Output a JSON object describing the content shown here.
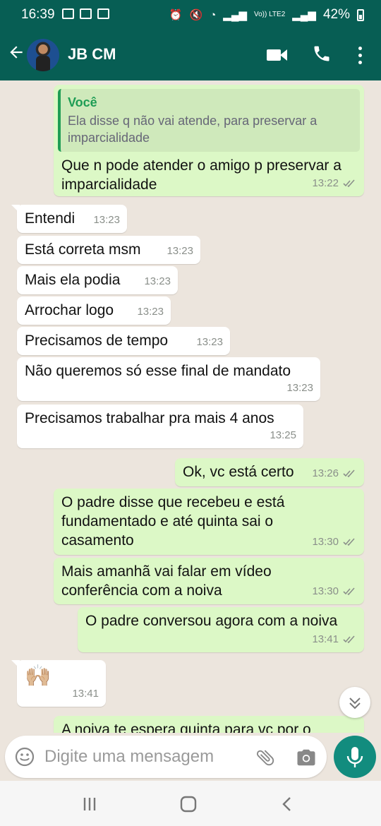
{
  "status_bar": {
    "time": "16:39",
    "network": "Vo)) LTE2",
    "battery": "42%"
  },
  "header": {
    "back_icon": "arrow-left-icon",
    "contact_name": "JB CM",
    "actions": [
      "video-call-icon",
      "voice-call-icon",
      "more-vert-icon"
    ]
  },
  "messages": [
    {
      "dir": "out",
      "quote_author": "Você",
      "quote_text": "Ela disse q não vai atende, para preservar a imparcialidade",
      "text": "Que n pode atender o amigo p preservar a imparcialidade",
      "time": "13:22"
    },
    {
      "dir": "in",
      "text": "Entendi",
      "time": "13:23"
    },
    {
      "dir": "in",
      "text": "Está correta msm",
      "time": "13:23"
    },
    {
      "dir": "in",
      "text": "Mais ela podia",
      "time": "13:23"
    },
    {
      "dir": "in",
      "text": "Arrochar logo",
      "time": "13:23"
    },
    {
      "dir": "in",
      "text": "Precisamos de tempo",
      "time": "13:23"
    },
    {
      "dir": "in",
      "text": "Não queremos só esse final de mandato",
      "time": "13:23"
    },
    {
      "dir": "in",
      "text": "Precisamos trabalhar pra mais 4 anos",
      "time": "13:25"
    },
    {
      "dir": "out",
      "text": "Ok, vc está certo",
      "time": "13:26"
    },
    {
      "dir": "out",
      "text": "O padre disse que recebeu e está fundamentado e até quinta sai o casamento",
      "time": "13:30"
    },
    {
      "dir": "out",
      "text": "Mais amanhã vai falar em vídeo conferência com a noiva",
      "time": "13:30"
    },
    {
      "dir": "out",
      "text": "O padre conversou agora com a noiva",
      "time": "13:41"
    },
    {
      "dir": "in",
      "text": "🙌🏼",
      "time": "13:41"
    },
    {
      "dir": "out",
      "text": "A noiva te espera quinta para vc por o",
      "time": ""
    }
  ],
  "composer": {
    "placeholder": "Digite uma mensagem",
    "icons": [
      "emoji-icon",
      "attach-icon",
      "camera-icon",
      "mic-icon"
    ]
  },
  "colors": {
    "header": "#075e54",
    "outgoing_bubble": "#dcf8c6",
    "incoming_bubble": "#ffffff",
    "chat_background": "#ece5dd",
    "accent": "#128c7e"
  }
}
